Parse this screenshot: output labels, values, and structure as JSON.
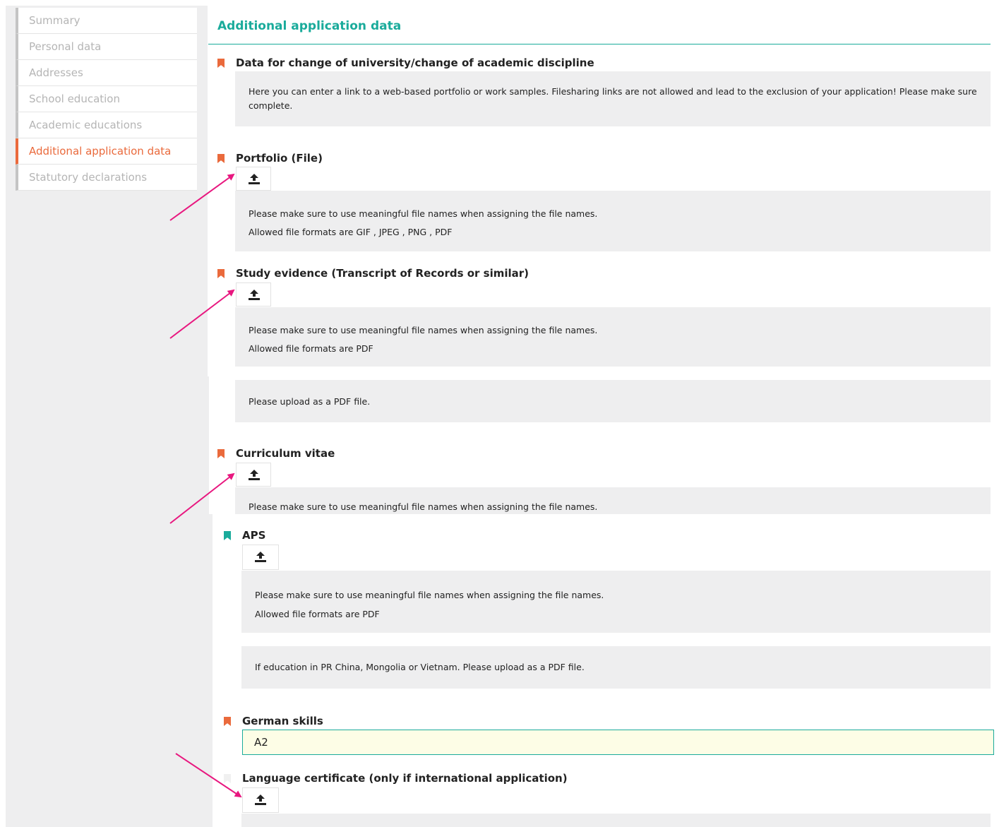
{
  "sidebar": {
    "items": [
      {
        "label": "Summary"
      },
      {
        "label": "Personal data"
      },
      {
        "label": "Addresses"
      },
      {
        "label": "School education"
      },
      {
        "label": "Academic educations"
      },
      {
        "label": "Additional application data",
        "active": true
      },
      {
        "label": "Statutory declarations"
      }
    ]
  },
  "main": {
    "title": "Additional application data",
    "change_section": {
      "title": "Data for change of university/change of academic discipline",
      "info_line1": "Here you can enter a link to a web-based portfolio or work samples. Filesharing links are not allowed and lead to the exclusion of your application! Please make sure",
      "info_line2": "complete."
    },
    "portfolio": {
      "title": "Portfolio (File)",
      "info_line1": "Please make sure to use meaningful file names when assigning the file names.",
      "info_line2": "Allowed file formats are GIF , JPEG , PNG , PDF"
    },
    "study_evidence": {
      "title": "Study evidence (Transcript of Records or similar)",
      "info_line1": "Please make sure to use meaningful file names when assigning the file names.",
      "info_line2": "Allowed file formats are PDF",
      "note": "Please upload as a PDF file."
    },
    "cv": {
      "title": "Curriculum vitae",
      "info_line1": "Please make sure to use meaningful file names when assigning the file names."
    },
    "aps": {
      "title": "APS",
      "info_line1": "Please make sure to use meaningful file names when assigning the file names.",
      "info_line2": "Allowed file formats are PDF",
      "note": "If education in PR China, Mongolia or Vietnam. Please upload as a PDF file."
    },
    "german_skills": {
      "title": "German skills",
      "value": "A2"
    },
    "language_certificate": {
      "title": "Language certificate (only if international application)"
    }
  },
  "colors": {
    "accent": "#1aab9b",
    "required_flag": "#ea6a3c",
    "optional_flag": "#1aab9b",
    "arrow": "#e8177f"
  },
  "icons": {
    "upload": "upload-icon",
    "flag": "bookmark-flag-icon"
  }
}
